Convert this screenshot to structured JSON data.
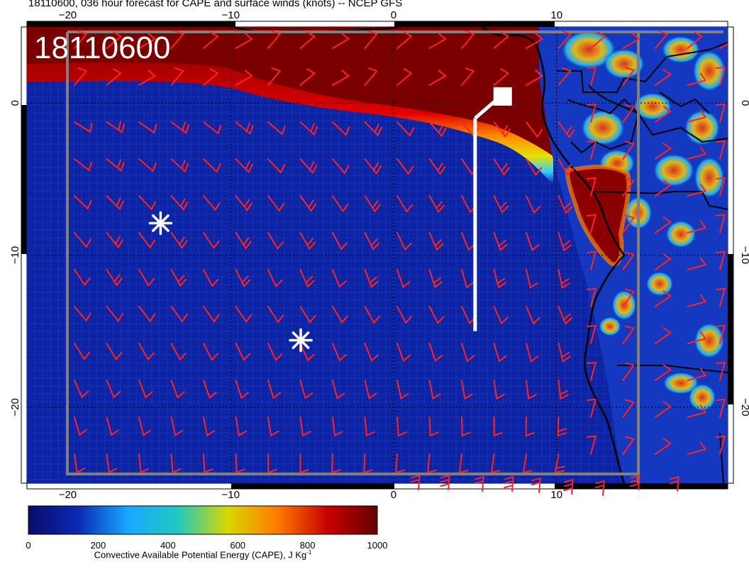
{
  "title": "18110600, 036 hour forecast for CAPE and surface winds (knots) -- NCEP GFS",
  "stamp": "18110600",
  "map": {
    "lon_range": [
      -22.5,
      20.5
    ],
    "lat_range": [
      -25.0,
      5.0
    ],
    "top_tick_labels": [
      "−20",
      "−10",
      "0",
      "10"
    ],
    "bottom_tick_labels": [
      "−20",
      "−10",
      "0",
      "10"
    ],
    "left_tick_labels": [
      "0",
      "−10",
      "−20"
    ],
    "right_tick_labels": [
      "0",
      "−10",
      "−20"
    ],
    "top_tick_lons": [
      -20,
      -10,
      0,
      10
    ],
    "bottom_tick_lons": [
      -20,
      -10,
      0,
      10
    ],
    "lat_ticks": [
      0,
      -10,
      -20
    ],
    "ocean_color": "#0a1e9a",
    "high_cape_color": "#7a0000",
    "barb_color": "#ff2222",
    "coast_color": "#000000",
    "markers": [
      {
        "name": "asterisk-1",
        "lon": -14.3,
        "lat": -7.9
      },
      {
        "name": "asterisk-2",
        "lon": -5.7,
        "lat": -15.6
      }
    ],
    "track_flag": {
      "lon_top": 6.3,
      "lat_top": 0.2,
      "lon_bottom": 5.0,
      "lat_bottom": -15.0
    }
  },
  "colorbar": {
    "ticks": [
      "0",
      "200",
      "400",
      "600",
      "800",
      "1000"
    ],
    "stops": [
      "#0a0a6a",
      "#0a2ab4",
      "#18a8ff",
      "#20c8c0",
      "#d8d800",
      "#ff7a00",
      "#c80000",
      "#640000"
    ],
    "label": "Convective Available Potential Energy (CAPE), J Kg",
    "label_sup": "-1"
  }
}
